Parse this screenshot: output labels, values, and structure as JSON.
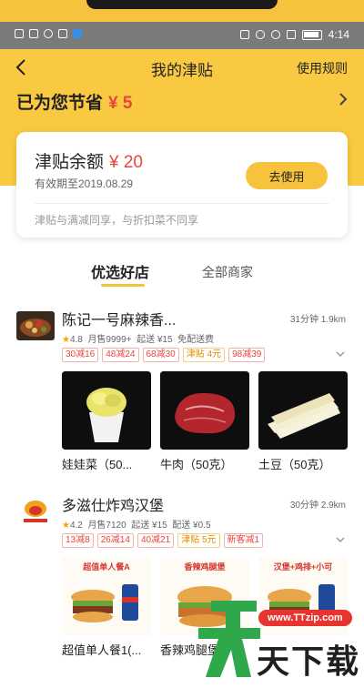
{
  "status_bar": {
    "time": "4:14"
  },
  "nav": {
    "title": "我的津贴",
    "rules_label": "使用规则"
  },
  "savings": {
    "label": "已为您节省",
    "amount": "¥ 5"
  },
  "balance_card": {
    "title": "津贴余额",
    "amount": "¥ 20",
    "expiry": "有效期至2019.08.29",
    "use_button": "去使用",
    "note": "津贴与满减同享，与折扣菜不同享"
  },
  "tabs": [
    {
      "label": "优选好店",
      "active": true
    },
    {
      "label": "全部商家",
      "active": false
    }
  ],
  "stores": [
    {
      "name": "陈记一号麻辣香...",
      "time_distance": "31分钟  1.9km",
      "rating": "4.8",
      "monthly_sales": "月售9999+",
      "delivery_min": "起送 ¥15",
      "delivery_fee": "免配送费",
      "tags": [
        "30减16",
        "48减24",
        "68减30",
        "津贴 4元",
        "98减39"
      ],
      "dishes": [
        {
          "name": "娃娃菜（50...",
          "icon": "cabbage-dish"
        },
        {
          "name": "牛肉（50克）",
          "icon": "beef-dish"
        },
        {
          "name": "土豆（50克）",
          "icon": "potato-dish"
        }
      ]
    },
    {
      "name": "多滋仕炸鸡汉堡",
      "time_distance": "30分钟  2.9km",
      "rating": "4.2",
      "monthly_sales": "月售7120",
      "delivery_min": "起送 ¥15",
      "delivery_fee": "配送 ¥0.5",
      "tags": [
        "13减8",
        "26减14",
        "40减21",
        "津贴 5元",
        "新客减1"
      ],
      "dishes": [
        {
          "name": "超值单人餐1(...",
          "icon": "burger-meal",
          "banner": "超值单人餐A"
        },
        {
          "name": "香辣鸡腿堡",
          "icon": "spicy-burger",
          "banner": "香辣鸡腿堡"
        },
        {
          "name": "",
          "icon": "burger-combo",
          "banner": "汉堡+鸡排+小可"
        }
      ]
    }
  ],
  "watermark": {
    "url": "www.TTzip.com",
    "brand": "天下载"
  },
  "colors": {
    "accent": "#f7c33c",
    "price_red": "#e8453c"
  }
}
